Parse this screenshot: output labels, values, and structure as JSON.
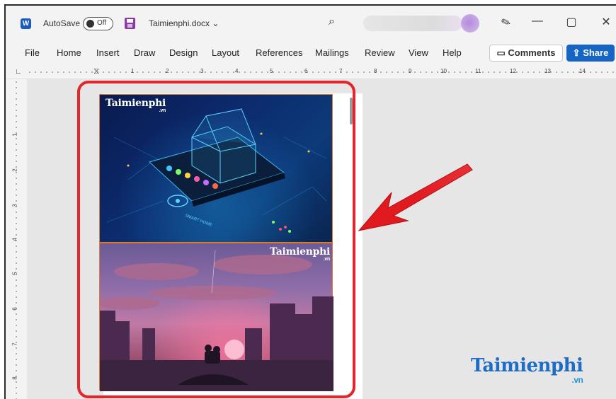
{
  "titlebar": {
    "autosave_label": "AutoSave",
    "autosave_state": "Off",
    "doc_name": "Taimienphi.docx",
    "doc_chevron": "⌄",
    "search_glyph": "⌕",
    "minimize_glyph": "—",
    "maximize_glyph": "▢",
    "close_glyph": "✕"
  },
  "ribbon": {
    "tabs": [
      "File",
      "Home",
      "Insert",
      "Draw",
      "Design",
      "Layout",
      "References",
      "Mailings",
      "Review",
      "View",
      "Help"
    ],
    "comments_label": "Comments",
    "share_label": "Share"
  },
  "ruler": {
    "numbers": [
      "1",
      "2",
      "3",
      "4",
      "5",
      "6",
      "7",
      "8",
      "9",
      "10",
      "11",
      "12",
      "13",
      "14"
    ],
    "vertical_numbers": [
      "1",
      "2",
      "3",
      "4",
      "5",
      "6",
      "7",
      "8"
    ]
  },
  "document": {
    "image1_watermark": "Taimienphi",
    "image1_watermark_suffix": ".vn",
    "image1_text": "SMART HOME",
    "image2_watermark": "Taimienphi",
    "image2_watermark_suffix": ".vn"
  },
  "overlay": {
    "brand": "Taimienphi",
    "brand_suffix": ".vn",
    "highlight_color": "#e3262b",
    "arrow_color": "#e3262b"
  },
  "colors": {
    "accent": "#1664c4",
    "word_blue": "#185abd",
    "save_purple": "#8c3aa8",
    "image_frame": "#e07a26"
  }
}
